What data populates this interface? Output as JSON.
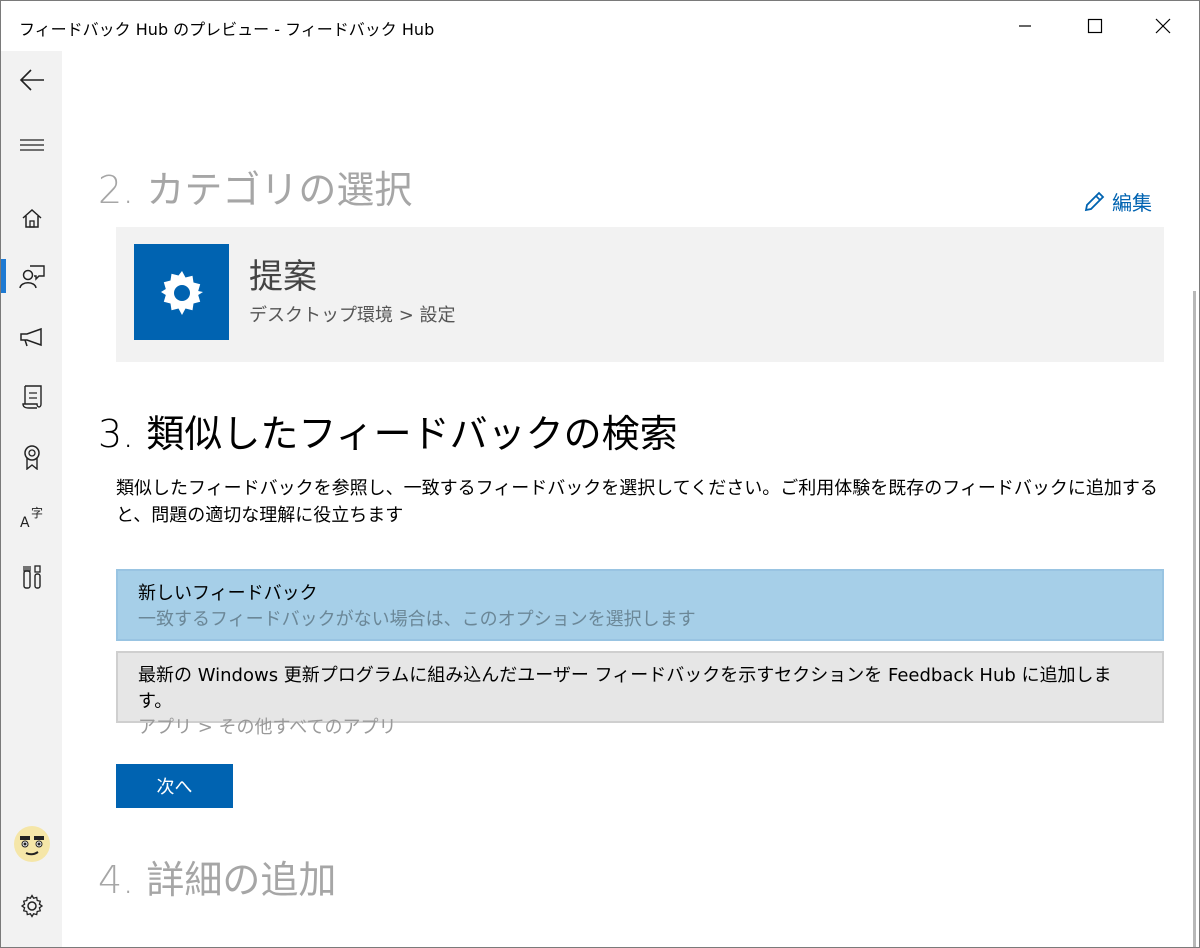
{
  "window": {
    "title": "フィードバック Hub のプレビュー - フィードバック Hub"
  },
  "nav": {
    "items": [
      {
        "icon": "back-arrow-icon"
      },
      {
        "icon": "hamburger-menu-icon"
      },
      {
        "icon": "home-icon"
      },
      {
        "icon": "feedback-person-icon",
        "active": true
      },
      {
        "icon": "megaphone-icon"
      },
      {
        "icon": "quest-scroll-icon"
      },
      {
        "icon": "achievement-ribbon-icon"
      },
      {
        "icon": "language-translate-icon"
      },
      {
        "icon": "tools-icon"
      },
      {
        "icon": "user-avatar-icon"
      },
      {
        "icon": "settings-gear-icon"
      }
    ],
    "accent": "#1e7ad2"
  },
  "step2": {
    "heading": "2. カテゴリの選択",
    "edit_label": "編集",
    "category": {
      "name": "提案",
      "path": "デスクトップ環境 > 設定",
      "icon": "settings-gear-icon",
      "tile_color": "#0063b1"
    }
  },
  "step3": {
    "heading": "3. 類似したフィードバックの検索",
    "description": "類似したフィードバックを参照し、一致するフィードバックを選択してください。ご利用体験を既存のフィードバックに追加すると、問題の適切な理解に役立ちます",
    "options": [
      {
        "title": "新しいフィードバック",
        "subtitle": "一致するフィードバックがない場合は、このオプションを選択します",
        "selected": true
      },
      {
        "title": "最新の Windows 更新プログラムに組み込んだユーザー フィードバックを示すセクションを Feedback Hub に追加します。",
        "subtitle": "アプリ > その他すべてのアプリ",
        "selected": false
      }
    ],
    "next_label": "次へ"
  },
  "step4": {
    "heading": "4. 詳細の追加"
  },
  "colors": {
    "accent": "#0063b1",
    "selected_bg": "#a6cfe8",
    "muted_heading": "#a6a6a6"
  }
}
